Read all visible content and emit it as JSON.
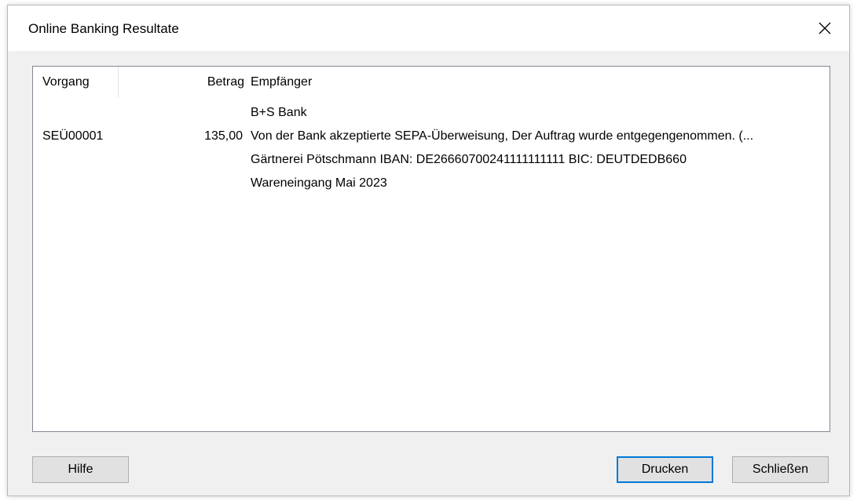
{
  "window": {
    "title": "Online Banking Resultate",
    "close_icon": "close-icon"
  },
  "list": {
    "columns": [
      "Vorgang",
      "Betrag",
      "Empfänger"
    ],
    "rows": [
      {
        "vorgang": "SEÜ00001",
        "betrag": "135,00",
        "empfaenger_lines": [
          "B+S Bank",
          "Von der Bank akzeptierte SEPA-Überweisung, Der Auftrag wurde entgegengenommen. (...",
          "Gärtnerei Pötschmann IBAN: DE26660700241111111111 BIC: DEUTDEDB660",
          "Wareneingang Mai 2023"
        ]
      }
    ]
  },
  "buttons": {
    "help": "Hilfe",
    "print": "Drucken",
    "close": "Schließen"
  },
  "colors": {
    "focus_border": "#0078d7",
    "dialog_bg": "#f0f0f0"
  }
}
